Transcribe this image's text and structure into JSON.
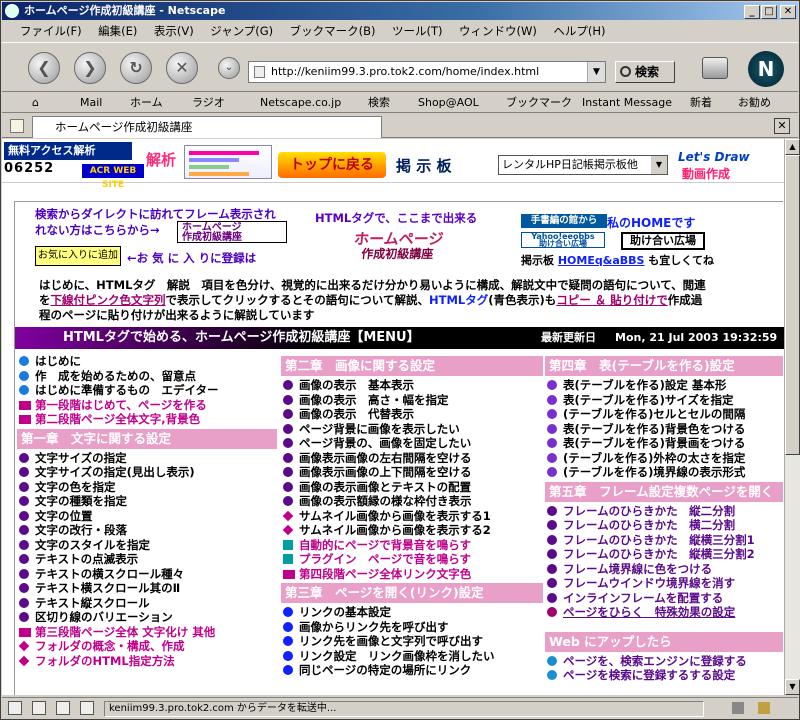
{
  "window": {
    "title": "ホームページ作成初級講座 - Netscape"
  },
  "menu": [
    "ファイル(F)",
    "編集(E)",
    "表示(V)",
    "ジャンプ(G)",
    "ブックマーク(B)",
    "ツール(T)",
    "ウィンドウ(W)",
    "ヘルプ(H)"
  ],
  "nav": {
    "url": "http://keniim99.3.pro.tok2.com/home/index.html",
    "search_label": "検索"
  },
  "bookmarks": [
    "Mail",
    "ホーム",
    "ラジオ",
    "Netscape.co.jp",
    "検索",
    "Shop@AOL",
    "ブックマーク",
    "Instant Message",
    "新着",
    "お勧め"
  ],
  "tab": {
    "label": "ホームページ作成初級講座"
  },
  "status": {
    "text": "keniim99.3.pro.tok2.com からデータを転送中..."
  },
  "banner": {
    "free_label": "無料アクセス解析",
    "counter": "06252",
    "kaiseki": "解析",
    "acr": "ACR WEB SITE",
    "top_btn": "トップに戻る",
    "keijiban": "掲 示 板",
    "select": "レンタルHP日記帳掲示板他",
    "lets_draw": "Let's Draw",
    "douga": "動画作成"
  },
  "header": {
    "search_direct": "検索からダイレクトに訪れてフレーム表示され",
    "search_direct2": "れない方はこちらから→",
    "hp_logo1": "ホームページ",
    "hp_logo2": "作成初級講座",
    "html_tag": "HTMLタグで、ここまで出来る",
    "fav_btn": "お気に入りに追加",
    "fav_text": "←お 気 に 入 りに登録は",
    "tegaki": "手書編の館から",
    "my_home": "私のHOMEです",
    "yahoo": "Yahoo!eeobbs",
    "tasuke": "助け合い広場",
    "tasuke2": "助け合い広場",
    "keijiban2": "掲示板",
    "home_bbs": "HOMEq&aBBS",
    "yoroshiku": "も宜しくてね",
    "logo_big1": "ホームページ",
    "logo_big2": "作成初級講座"
  },
  "intro": {
    "line1": "はじめに、HTMLタグ　解説　項目を色分け、視覚的に出来るだけ分かり易いように構成、解説文中で疑問の語句について、閲連",
    "line2a": "を",
    "line2b": "下線付ピンク色文字列",
    "line2c": "で表示してクリックするとその語句について解説、",
    "line2d": "HTMLタグ",
    "line2e": "(青色表示)も",
    "line2f": "コピー ＆ 貼り付けで",
    "line2g": "作成過",
    "line3": "程のページに貼り付けが出来るように解説しています"
  },
  "menuhead": {
    "title": "HTMLタグで始める、ホームページ作成初級講座【MENU】",
    "updated_label": "最新更新日",
    "updated": "Mon, 21 Jul 2003 19:32:59 GMT"
  },
  "col1": {
    "top": [
      "はじめに",
      "作　成を始めるための、留意点",
      "はじめに準備するもの　エデイター"
    ],
    "pink": [
      "第一段階はじめて、ページを作る",
      "第二段階ページ全体文字,背景色"
    ],
    "sec1": "第一章　文字に関する設定",
    "items1": [
      "文字サイズの指定",
      "文字サイズの指定(見出し表示)",
      "文字の色を指定",
      "文字の種類を指定",
      "文字の位置",
      "文字の改行・段落",
      "文字のスタイルを指定",
      "テキストの点滅表示",
      "テキストの横スクロール種々",
      "テキスト横スクロール其のⅡ",
      "テキスト縦スクロール",
      "区切り線のバリエーション"
    ],
    "pink2": "第三段階ページ全体 文字化け 其他",
    "items2": [
      "フォルダの概念・構成、作成",
      "フォルダのHTML指定方法"
    ]
  },
  "col2": {
    "sec2": "第二章　画像に関する設定",
    "items": [
      "画像の表示　基本表示",
      "画像の表示　高さ・幅を指定",
      "画像の表示　代替表示",
      "ページ背景に画像を表示したい",
      "ページ背景の、画像を固定したい",
      "画像表示画像の左右間隔を空ける",
      "画像表示画像の上下間隔を空ける",
      "画像の表示画像とテキストの配置",
      "画像の表示額縁の様な枠付き表示"
    ],
    "thumb": [
      "サムネイル画像から画像を表示する1",
      "サムネイル画像から画像を表示する2"
    ],
    "auto": [
      "自動的にページで背景音を鳴らす",
      "プラグイン　ページで音を鳴らす"
    ],
    "pink4": "第四段階ページ全体リンク文字色",
    "sec3": "第三章　ページを開く(リンク)設定",
    "links": [
      "リンクの基本設定",
      "画像からリンク先を呼び出す",
      "リンク先を画像と文字列で呼び出す",
      "リンク設定　リンク画像枠を消したい",
      "同じページの特定の場所にリンク"
    ]
  },
  "col3": {
    "sec4": "第四章　表(テーブルを作る)設定",
    "items": [
      "表(テーブルを作る)設定 基本形",
      "表(テーブルを作る)サイズを指定",
      "(テーブルを作る)セルとセルの間隔",
      "表(テーブルを作る)背景色をつける",
      "表(テーブルを作る)背景画をつける",
      "(テーブルを作る)外枠の太さを指定",
      "(テーブルを作る)境界線の表示形式"
    ],
    "sec5": "第五章　フレーム設定複数ページを開く",
    "frames": [
      "フレームのひらきかた　縦二分割",
      "フレームのひらきかた　横二分割",
      "フレームのひらきかた　縦横三分割1",
      "フレームのひらきかた　縦横三分割2",
      "フレーム境界線に色をつける",
      "フレームウインドウ境界線を消す",
      "インラインフレームを配置する"
    ],
    "special": "ページをひらく　特殊効果の設定",
    "web": "Web にアップしたら",
    "web_items": [
      "ページを、検索エンジンに登録する",
      "ページを検索に登録するする設定"
    ]
  },
  "colors": {
    "purple": "#5a0a8a",
    "pink": "#c0008a",
    "blue": "#1020ff",
    "teal": "#00a0a0",
    "sec_bg": "#e8a0c8"
  }
}
